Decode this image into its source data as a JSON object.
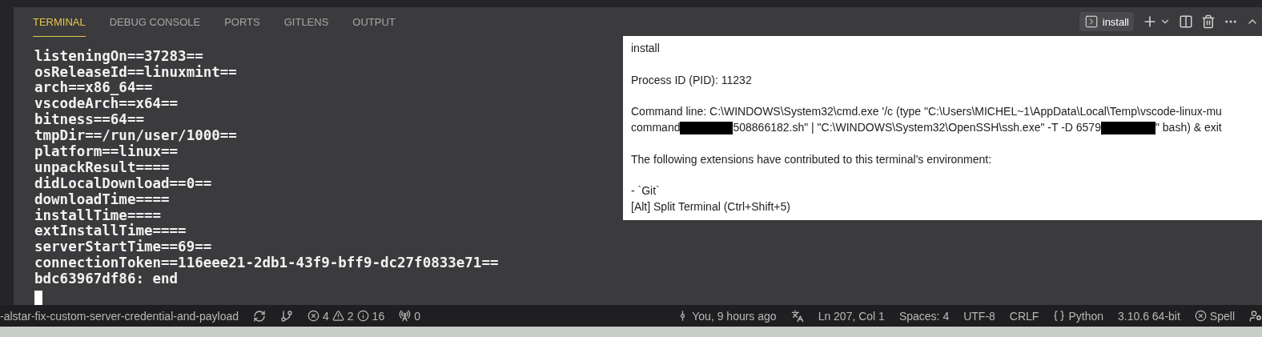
{
  "tabs": [
    {
      "label": "TERMINAL",
      "selected": true
    },
    {
      "label": "DEBUG CONSOLE",
      "selected": false
    },
    {
      "label": "PORTS",
      "selected": false
    },
    {
      "label": "GITLENS",
      "selected": false
    },
    {
      "label": "OUTPUT",
      "selected": false
    }
  ],
  "terminal_toolbar": {
    "terminal_name": "install"
  },
  "terminal": {
    "lines": [
      "listeningOn==37283==",
      "osReleaseId==linuxmint==",
      "arch==x86_64==",
      "vscodeArch==x64==",
      "bitness==64==",
      "tmpDir==/run/user/1000==",
      "platform==linux==",
      "unpackResult====",
      "didLocalDownload==0==",
      "downloadTime====",
      "installTime====",
      "extInstallTime====",
      "serverStartTime==69==",
      "connectionToken==116eee21-2db1-43f9-bff9-dc27f0833e71==",
      "bdc63967df86: end"
    ]
  },
  "hover": {
    "title": "install",
    "pid": "Process ID (PID): 11232",
    "command_line": [
      "Command line: C:\\WINDOWS\\System32\\cmd.exe '/c (type \"C:\\Users\\MICHEL~1\\AppData\\Local\\Temp\\vscode-linux-mu",
      "command",
      "508866182.sh\" | \"C:\\WINDOWS\\System32\\OpenSSH\\ssh.exe\" -T -D 6579 ",
      "\" bash) & exit"
    ],
    "extensions_note": "The following extensions have contributed to this terminal's environment:",
    "extension": "- `Git`",
    "hint": "[Alt] Split Terminal (Ctrl+Shift+5)"
  },
  "status_bar": {
    "branch": "-alstar-fix-custom-server-credential-and-payload",
    "errors": "4",
    "warnings": "2",
    "infos": "16",
    "ports": "0",
    "blame": "You, 9 hours ago",
    "position": "Ln 207, Col 1",
    "indentation": "Spaces: 4",
    "encoding": "UTF-8",
    "eol": "CRLF",
    "language": "Python",
    "interpreter": "3.10.6 64-bit",
    "spell": "Spell"
  }
}
